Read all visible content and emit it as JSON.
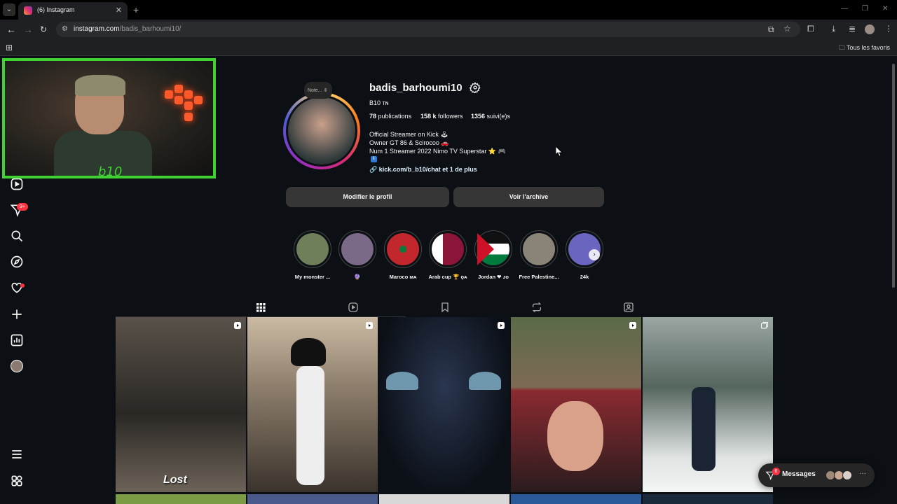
{
  "browser": {
    "tab_title": "(6) Instagram",
    "url_host": "instagram.com",
    "url_path": "/badis_barhoumi10/",
    "bookmarks_folder": "Tous les favoris"
  },
  "left_nav": {
    "notifications_badge": "9+"
  },
  "profile": {
    "note": "Note...",
    "username": "badis_barhoumi10",
    "full_name": "B10 ᴛɴ",
    "stats": {
      "posts": "78",
      "posts_label": "publications",
      "followers": "158 k",
      "followers_label": "followers",
      "following": "1356",
      "following_label": "suivi(e)s"
    },
    "bio": [
      "Official Streamer on Kick 🕹",
      "Owner GT 86 & Scirocoo 🚗",
      "Num 1 Streamer 2022 Nimo TV Superstar ⭐ 🎮"
    ],
    "bio_line4": "ℹ",
    "link": "kick.com/b_b10/chat et 1 de plus",
    "edit_button": "Modifier le profil",
    "archive_button": "Voir l'archive"
  },
  "highlights": [
    {
      "label": "My monster ...",
      "color": "#6f7f5a"
    },
    {
      "label": "🔮",
      "color": "#7a6a88"
    },
    {
      "label": "Maroco ᴍᴀ",
      "color": "#c1272d"
    },
    {
      "label": "Arab cup 🏆 ǫᴀ",
      "color": "#8a1538"
    },
    {
      "label": "Jordan ❤ ᴊᴏ",
      "color": "#007a3d"
    },
    {
      "label": "Free Palestine...",
      "color": "#8a8478"
    },
    {
      "label": "24k",
      "color": "#6a66c0"
    }
  ],
  "posts": [
    {
      "caption": "Lost",
      "color1": "#4b4540",
      "color2": "#232120",
      "type": "reel"
    },
    {
      "caption": "",
      "color1": "#b8aa96",
      "color2": "#3a332c",
      "type": "reel"
    },
    {
      "caption": "",
      "color1": "#1d2633",
      "color2": "#0b0f16",
      "type": "reel"
    },
    {
      "caption": "",
      "color1": "#8a2a30",
      "color2": "#2a1c1e",
      "type": "reel"
    },
    {
      "caption": "",
      "color1": "#7d8b86",
      "color2": "#dfe3e2",
      "type": "carousel"
    }
  ],
  "messages": {
    "label": "Messages",
    "badge": "6"
  },
  "colors": {
    "accent_green": "#3fd232",
    "notification_red": "#ff3040",
    "background": "#0c1014"
  }
}
